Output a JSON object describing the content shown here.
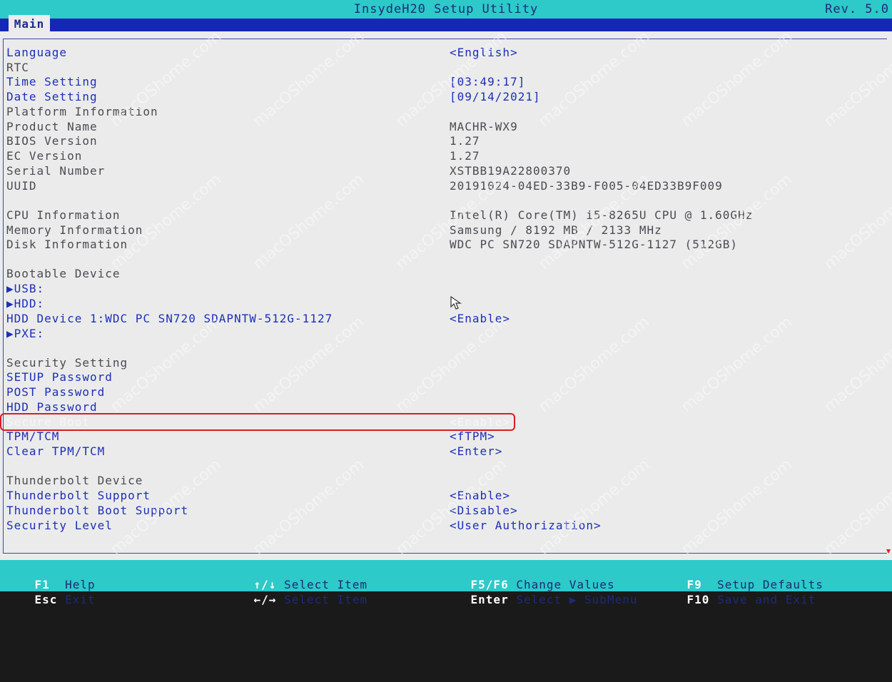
{
  "window": {
    "title": "InsydeH20 Setup Utility",
    "revision": "Rev. 5.0"
  },
  "tabs": [
    {
      "label": "Main",
      "selected": true
    }
  ],
  "rows": [
    {
      "label": "Language",
      "value": "<English>",
      "style": "blue"
    },
    {
      "label": "RTC",
      "value": "",
      "style": "grey"
    },
    {
      "label": "Time Setting",
      "value": "[03:49:17]",
      "style": "blue"
    },
    {
      "label": "Date Setting",
      "value": "[09/14/2021]",
      "style": "blue"
    },
    {
      "label": "Platform Information",
      "value": "",
      "style": "grey"
    },
    {
      "label": "Product Name",
      "value": "MACHR-WX9",
      "style": "grey"
    },
    {
      "label": "BIOS Version",
      "value": "1.27",
      "style": "grey"
    },
    {
      "label": "EC Version",
      "value": "1.27",
      "style": "grey"
    },
    {
      "label": "Serial Number",
      "value": "XSTBB19A22800370",
      "style": "grey"
    },
    {
      "label": "UUID",
      "value": "20191024-04ED-33B9-F005-04ED33B9F009",
      "style": "grey"
    },
    {
      "label": "CPU Information",
      "value": "Intel(R) Core(TM) i5-8265U CPU @ 1.60GHz",
      "style": "grey"
    },
    {
      "label": "Memory Information",
      "value": "Samsung / 8192 MB / 2133 MHz",
      "style": "grey"
    },
    {
      "label": "Disk Information",
      "value": "WDC PC SN720 SDAPNTW-512G-1127 (512GB)",
      "style": "grey"
    },
    {
      "label": "Bootable Device",
      "value": "",
      "style": "grey"
    },
    {
      "label": "▶USB:",
      "value": "",
      "style": "blue"
    },
    {
      "label": "▶HDD:",
      "value": "",
      "style": "blue"
    },
    {
      "label": "HDD Device 1:WDC PC SN720 SDAPNTW-512G-1127",
      "value": "<Enable>",
      "style": "blue"
    },
    {
      "label": "▶PXE:",
      "value": "",
      "style": "blue"
    },
    {
      "label": "Security Setting",
      "value": "",
      "style": "grey"
    },
    {
      "label": "SETUP Password",
      "value": "",
      "style": "blue"
    },
    {
      "label": "POST Password",
      "value": "",
      "style": "blue"
    },
    {
      "label": "HDD Password",
      "value": "",
      "style": "blue"
    },
    {
      "label": "Secure Boot",
      "value": "<Enable>",
      "style": "sel",
      "selected": true
    },
    {
      "label": "TPM/TCM",
      "value": "<fTPM>",
      "style": "blue"
    },
    {
      "label": "Clear TPM/TCM",
      "value": "<Enter>",
      "style": "blue"
    },
    {
      "label": "Thunderbolt Device",
      "value": "",
      "style": "grey"
    },
    {
      "label": "Thunderbolt Support",
      "value": "<Enable>",
      "style": "blue"
    },
    {
      "label": "Thunderbolt Boot Support",
      "value": "<Disable>",
      "style": "blue"
    },
    {
      "label": "Security Level",
      "value": "<User Authorization>",
      "style": "blue"
    }
  ],
  "watermark_text": "macOShome.com",
  "footer": {
    "items": [
      {
        "key": "F1",
        "desc": "Help"
      },
      {
        "key": "Esc",
        "desc": "Exit"
      },
      {
        "key": "↑/↓",
        "desc": "Select Item"
      },
      {
        "key": "←/→",
        "desc": "Select Item"
      },
      {
        "key": "F5/F6",
        "desc": "Change Values"
      },
      {
        "key": "Enter",
        "desc": "Select ▶ SubMenu"
      },
      {
        "key": "F9",
        "desc": "Setup Defaults"
      },
      {
        "key": "F10",
        "desc": "Save and Exit"
      }
    ]
  },
  "colors": {
    "title_bar": "#2ec9c9",
    "tab_bar": "#1428b4",
    "panel_bg": "#ebebeb",
    "item_blue": "#1c2fb8",
    "info_grey": "#4a4a52",
    "highlight_box": "#d81e24"
  },
  "icons": {
    "cursor": "mouse-pointer-icon",
    "submenu": "triangle-right-icon"
  }
}
